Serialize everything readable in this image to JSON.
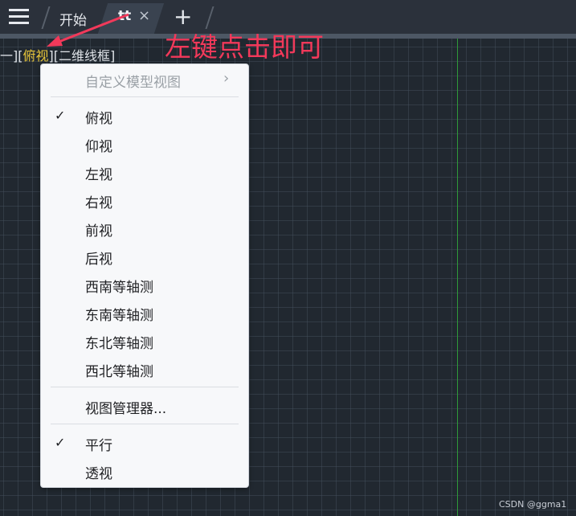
{
  "tabbar": {
    "menu_icon": "hamburger-menu-icon",
    "tabs": [
      {
        "label": "开始"
      },
      {
        "label": "tt",
        "close_symbol": "×"
      }
    ],
    "add_symbol": "+"
  },
  "viewport_controls": {
    "prefix": "一][",
    "view": "俯视",
    "middle": "][",
    "style": "二维线框",
    "suffix": "]"
  },
  "annotation": {
    "text": "左键点击即可",
    "color": "#f2395a"
  },
  "menu": {
    "submenu_item": {
      "label": "自定义模型视图",
      "chevron": "›"
    },
    "views": [
      {
        "label": "俯视",
        "checked": true,
        "check": "✓"
      },
      {
        "label": "仰视"
      },
      {
        "label": "左视"
      },
      {
        "label": "右视"
      },
      {
        "label": "前视"
      },
      {
        "label": "后视"
      },
      {
        "label": "西南等轴测"
      },
      {
        "label": "东南等轴测"
      },
      {
        "label": "东北等轴测"
      },
      {
        "label": "西北等轴测"
      }
    ],
    "manager": {
      "label": "视图管理器..."
    },
    "projection": [
      {
        "label": "平行",
        "checked": true,
        "check": "✓"
      },
      {
        "label": "透视"
      }
    ]
  },
  "watermark": "CSDN @ggma1",
  "colors": {
    "background": "#212830",
    "highlight": "#e8c63a",
    "axis_line": "#2f9a3a"
  }
}
